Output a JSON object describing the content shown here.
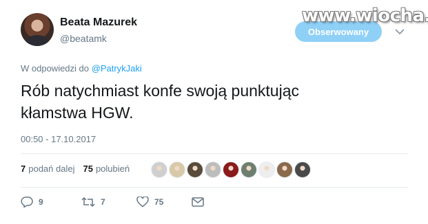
{
  "author": {
    "display_name": "Beata Mazurek",
    "screen_name": "@beatamk"
  },
  "follow_button_label": "Obserwowany",
  "watermark": "www.wiocha.pl",
  "reply_context": {
    "prefix": "W odpowiedzi do",
    "mention": "@PatrykJaki"
  },
  "tweet": {
    "line1": "Rób natychmiast konfe swoją punktując",
    "line2": "kłamstwa HGW."
  },
  "timestamp": "00:50 - 17.10.2017",
  "stats": {
    "retweets_count": "7",
    "retweets_label": "podań dalej",
    "likes_count": "75",
    "likes_label": "polubień"
  },
  "liker_avatars": [
    "#cfcfcf",
    "#d8c9a8",
    "#5a4a3a",
    "#bdbdbd",
    "#8b1a1a",
    "#6f7f6f",
    "#eeeeee",
    "#8a6a4a",
    "#4a4a4a"
  ],
  "actions": {
    "reply_count": "9",
    "retweet_count": "7",
    "like_count": "75"
  },
  "colors": {
    "accent": "#1da1f2",
    "follow_button": "#8fd0f7",
    "secondary_text": "#657786"
  },
  "icons": {
    "reply": "reply-icon",
    "retweet": "retweet-icon",
    "like": "heart-icon",
    "dm": "envelope-icon",
    "caret": "chevron-down-icon"
  }
}
